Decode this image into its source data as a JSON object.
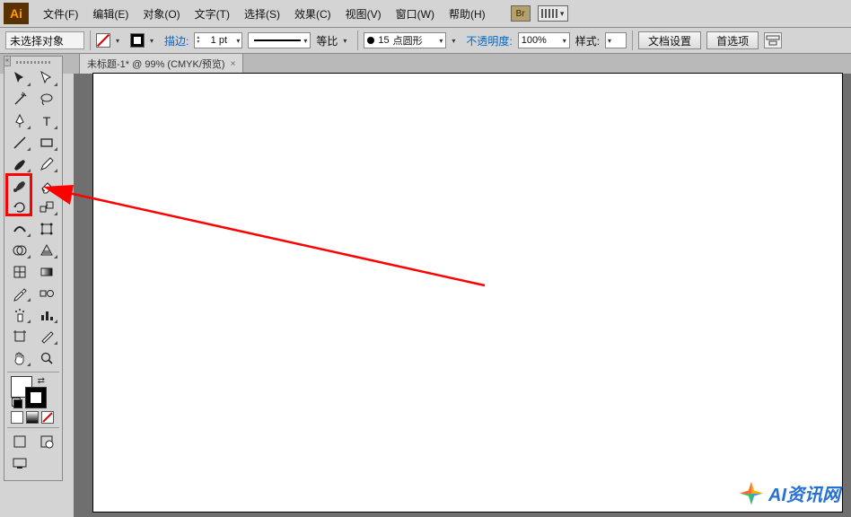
{
  "logo": "Ai",
  "menus": [
    "文件(F)",
    "编辑(E)",
    "对象(O)",
    "文字(T)",
    "选择(S)",
    "效果(C)",
    "视图(V)",
    "窗口(W)",
    "帮助(H)"
  ],
  "menu_br_badge": "Br",
  "options": {
    "selection_state": "未选择对象",
    "stroke_label": "描边:",
    "stroke_pt": "1 pt",
    "proportion_label": "等比",
    "brush_size": "15",
    "brush_name": "点圆形",
    "opacity_label": "不透明度:",
    "opacity_value": "100%",
    "style_label": "样式:",
    "doc_setup": "文档设置",
    "prefs": "首选项"
  },
  "tab": {
    "label": "未标题-1* @ 99% (CMYK/预览)",
    "close": "×"
  },
  "tools": {
    "row1": [
      "selection",
      "direct-selection"
    ],
    "row2": [
      "magic-wand",
      "lasso"
    ],
    "row3": [
      "pen",
      "type"
    ],
    "row4": [
      "line",
      "rectangle"
    ],
    "row5": [
      "paintbrush",
      "pencil"
    ],
    "row6": [
      "blob-brush",
      "eraser"
    ],
    "row7": [
      "rotate",
      "scale"
    ],
    "row8": [
      "width",
      "free-transform"
    ],
    "row9": [
      "shape-builder",
      "perspective"
    ],
    "row10": [
      "mesh",
      "gradient"
    ],
    "row11": [
      "eyedropper",
      "blend"
    ],
    "row12": [
      "symbol-sprayer",
      "column-graph"
    ],
    "row13": [
      "artboard",
      "slice"
    ],
    "row14": [
      "hand",
      "zoom"
    ]
  },
  "watermark": "AI资讯网"
}
